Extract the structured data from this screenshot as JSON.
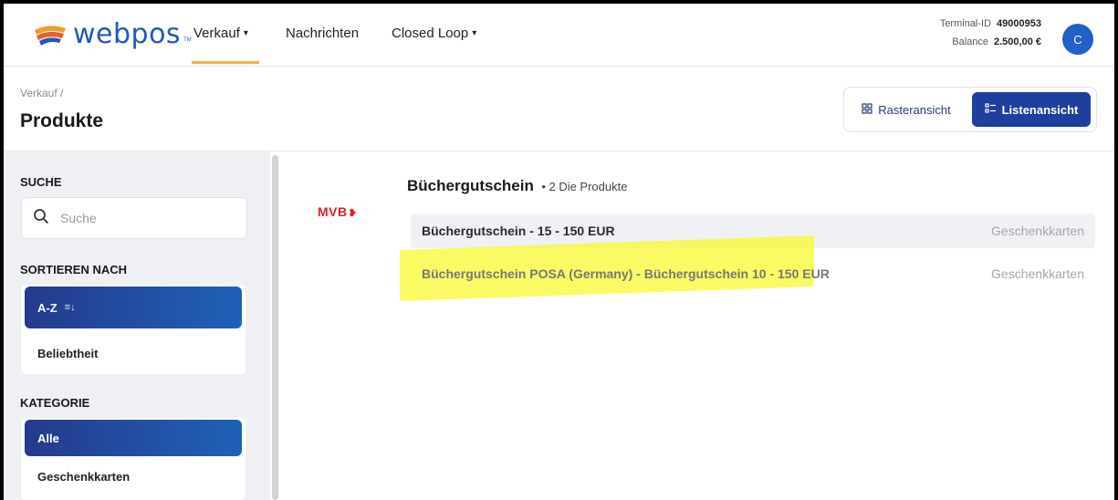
{
  "brand": {
    "name": "webpos",
    "tm": "TM",
    "colors": {
      "primary": "#1e3f9c",
      "accent": "#f0b24a",
      "logo_text": "#2258b8"
    }
  },
  "nav": {
    "items": [
      {
        "label": "Verkauf",
        "has_dropdown": true,
        "active": true
      },
      {
        "label": "Nachrichten",
        "has_dropdown": false
      },
      {
        "label": "Closed Loop",
        "has_dropdown": true
      }
    ],
    "caret": "▾"
  },
  "terminal": {
    "id_label": "Terminal-ID",
    "id_value": "49000953",
    "balance_label": "Balance",
    "balance_value": "2.500,00 €"
  },
  "user": {
    "avatar_initial": "C"
  },
  "page": {
    "breadcrumb": "Verkauf /",
    "title": "Produkte",
    "view_toggle": {
      "grid_label": "Rasteransicht",
      "grid_icon": "grid-icon",
      "list_label": "Listenansicht",
      "list_icon": "list-icon",
      "selected": "Listenansicht"
    }
  },
  "sidebar": {
    "search": {
      "title": "SUCHE",
      "placeholder": "Suche",
      "icon": "search-icon"
    },
    "sort": {
      "title": "SORTIEREN NACH",
      "options": [
        {
          "label": "A-Z",
          "icon": "sort-az-icon",
          "active": true
        },
        {
          "label": "Beliebtheit",
          "active": false
        }
      ]
    },
    "category": {
      "title": "KATEGORIE",
      "options": [
        {
          "label": "Alle",
          "active": true
        },
        {
          "label": "Geschenkkarten",
          "active": false
        }
      ]
    }
  },
  "main": {
    "brand_logo": "MVB",
    "group_name": "Büchergutschein",
    "group_count": "• 2 Die Produkte",
    "products": [
      {
        "name": "Büchergutschein - 15 - 150 EUR",
        "category": "Geschenkkarten"
      },
      {
        "name": "Büchergutschein POSA (Germany) - Büchergutschein 10 - 150 EUR",
        "category": "Geschenkkarten",
        "highlighted": true
      }
    ]
  }
}
